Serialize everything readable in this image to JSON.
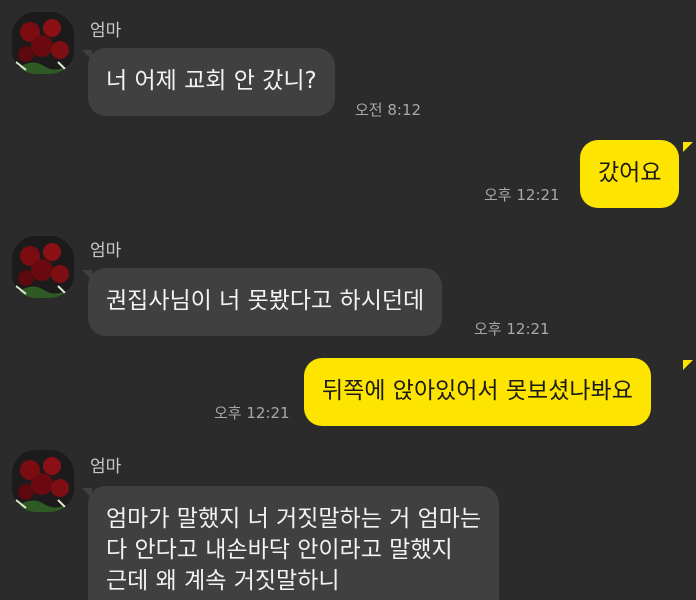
{
  "messages": [
    {
      "sender": "엄마",
      "text": "너 어제 교회 안 갔니?",
      "time": "오전 8:12"
    },
    {
      "text": "갔어요",
      "time": "오후 12:21"
    },
    {
      "sender": "엄마",
      "text": "권집사님이 너 못봤다고 하시던데",
      "time": "오후 12:21"
    },
    {
      "text": "뒤쪽에 앉아있어서 못보셨나봐요",
      "time": "오후 12:21"
    },
    {
      "sender": "엄마",
      "lines": [
        "엄마가 말했지 너 거짓말하는 거 엄마는",
        "다 안다고 내손바닥 안이라고 말했지",
        "근데 왜 계속 거짓말하니"
      ]
    }
  ],
  "colors": {
    "background": "#2b2b2b",
    "incoming_bubble": "#404040",
    "outgoing_bubble": "#fee500"
  },
  "icons": {
    "avatar": "red-roses-profile-photo"
  }
}
